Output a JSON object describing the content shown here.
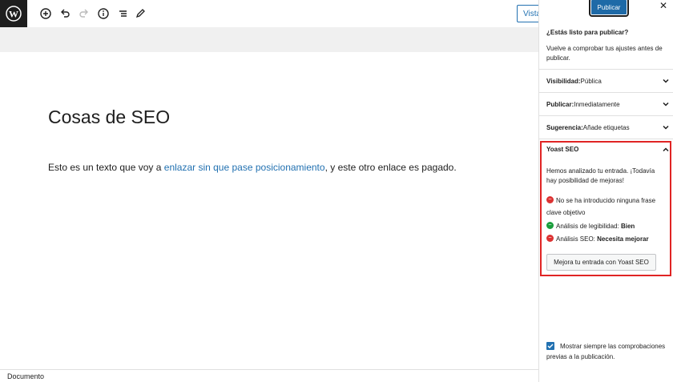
{
  "toolbar": {
    "vista_label": "Vista"
  },
  "editor": {
    "title": "Cosas de SEO",
    "para_before": "Esto es un texto que voy a ",
    "para_link": "enlazar sin que pase posicionamiento",
    "para_after": ", y este otro enlace es pagado."
  },
  "statusbar": {
    "label": "Documento"
  },
  "panel": {
    "publish_label": "Publicar",
    "close_label": "✕",
    "ready_title": "¿Estás listo para publicar?",
    "ready_desc": "Vuelve a comprobar tus ajustes antes de publicar.",
    "rows": [
      {
        "key": "Visibilidad:",
        "value": " Pública"
      },
      {
        "key": "Publicar:",
        "value": " Inmediatamente"
      },
      {
        "key": "Sugerencia:",
        "value": " Añade etiquetas"
      }
    ],
    "yoast": {
      "title": "Yoast SEO",
      "intro": "Hemos analizado tu entrada. ¡Todavía hay posibilidad de mejoras!",
      "keyphrase": "No se ha introducido ninguna frase clave objetivo",
      "readability_label": "Análisis de legibilidad: ",
      "readability_value": "Bien",
      "seo_label": "Análisis SEO: ",
      "seo_value": "Necesita mejorar",
      "button": "Mejora tu entrada con Yoast SEO"
    },
    "always_show": "Mostrar siempre las comprobaciones previas a la publicación.",
    "always_show_checked": true
  },
  "colors": {
    "accent": "#2271b1",
    "publish": "#1e6aa7",
    "highlight": "#e02424",
    "good": "#1a9e3c",
    "bad": "#dc3232"
  }
}
